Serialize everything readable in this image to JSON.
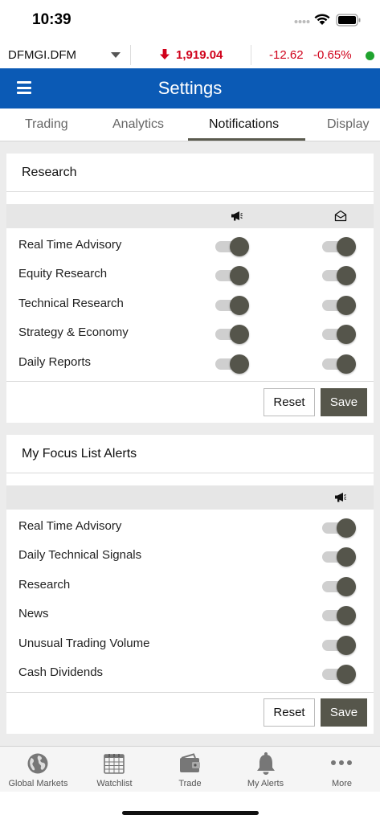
{
  "status_bar": {
    "time": "10:39"
  },
  "ticker": {
    "symbol": "DFMGI.DFM",
    "price": "1,919.04",
    "change": "-12.62",
    "change_pct": "-0.65%",
    "colors": {
      "down": "#d0021b",
      "live": "#1fa32e"
    }
  },
  "header": {
    "title": "Settings",
    "color": "#0b5ab5"
  },
  "tabs": [
    {
      "label": "Trading"
    },
    {
      "label": "Analytics"
    },
    {
      "label": "Notifications",
      "active": true
    },
    {
      "label": "Display"
    }
  ],
  "research": {
    "title": "Research",
    "columns": [
      {
        "icon": "megaphone-icon"
      },
      {
        "icon": "envelope-open-icon"
      }
    ],
    "rows": [
      {
        "label": "Real Time Advisory",
        "push": true,
        "email": true
      },
      {
        "label": "Equity Research",
        "push": true,
        "email": true
      },
      {
        "label": "Technical Research",
        "push": true,
        "email": true
      },
      {
        "label": "Strategy & Economy",
        "push": true,
        "email": true
      },
      {
        "label": "Daily Reports",
        "push": true,
        "email": true
      }
    ],
    "reset_label": "Reset",
    "save_label": "Save"
  },
  "focus_list": {
    "title": "My Focus List Alerts",
    "columns": [
      {
        "icon": "megaphone-icon"
      }
    ],
    "rows": [
      {
        "label": "Real Time Advisory",
        "push": true
      },
      {
        "label": "Daily Technical Signals",
        "push": true
      },
      {
        "label": "Research",
        "push": true
      },
      {
        "label": "News",
        "push": true
      },
      {
        "label": "Unusual Trading Volume",
        "push": true
      },
      {
        "label": "Cash Dividends",
        "push": true
      }
    ],
    "reset_label": "Reset",
    "save_label": "Save"
  },
  "bottom_nav": [
    {
      "label": "Global Markets",
      "icon": "globe-icon"
    },
    {
      "label": "Watchlist",
      "icon": "calendar-grid-icon"
    },
    {
      "label": "Trade",
      "icon": "wallet-icon"
    },
    {
      "label": "My Alerts",
      "icon": "bell-icon"
    },
    {
      "label": "More",
      "icon": "more-dots-icon"
    }
  ],
  "accent_color": "#56564b"
}
